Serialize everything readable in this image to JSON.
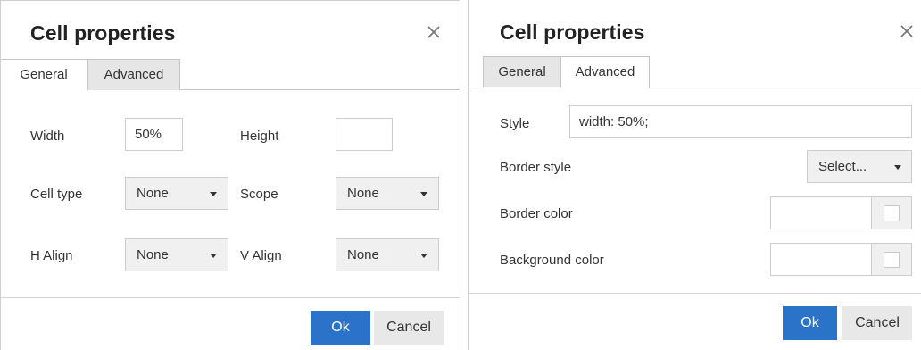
{
  "dialogs": {
    "general": {
      "title": "Cell properties",
      "tabs": [
        "General",
        "Advanced"
      ],
      "active_tab": "General",
      "fields": {
        "width_label": "Width",
        "width_value": "50%",
        "height_label": "Height",
        "height_value": "",
        "cell_type_label": "Cell type",
        "cell_type_value": "None",
        "scope_label": "Scope",
        "scope_value": "None",
        "h_align_label": "H Align",
        "h_align_value": "None",
        "v_align_label": "V Align",
        "v_align_value": "None"
      },
      "buttons": {
        "ok": "Ok",
        "cancel": "Cancel"
      }
    },
    "advanced": {
      "title": "Cell properties",
      "tabs": [
        "General",
        "Advanced"
      ],
      "active_tab": "Advanced",
      "fields": {
        "style_label": "Style",
        "style_value": "width: 50%;",
        "border_style_label": "Border style",
        "border_style_value": "Select...",
        "border_color_label": "Border color",
        "border_color_value": "",
        "background_color_label": "Background color",
        "background_color_value": ""
      },
      "buttons": {
        "ok": "Ok",
        "cancel": "Cancel"
      }
    }
  },
  "icons": {
    "close": "close-icon",
    "dropdown": "chevron-down-icon",
    "color_swatch": "color-swatch-icon"
  },
  "colors": {
    "primary_button": "#2b73c8",
    "inactive_tab": "#e6e6e6",
    "select_bg": "#f0f0f0"
  }
}
